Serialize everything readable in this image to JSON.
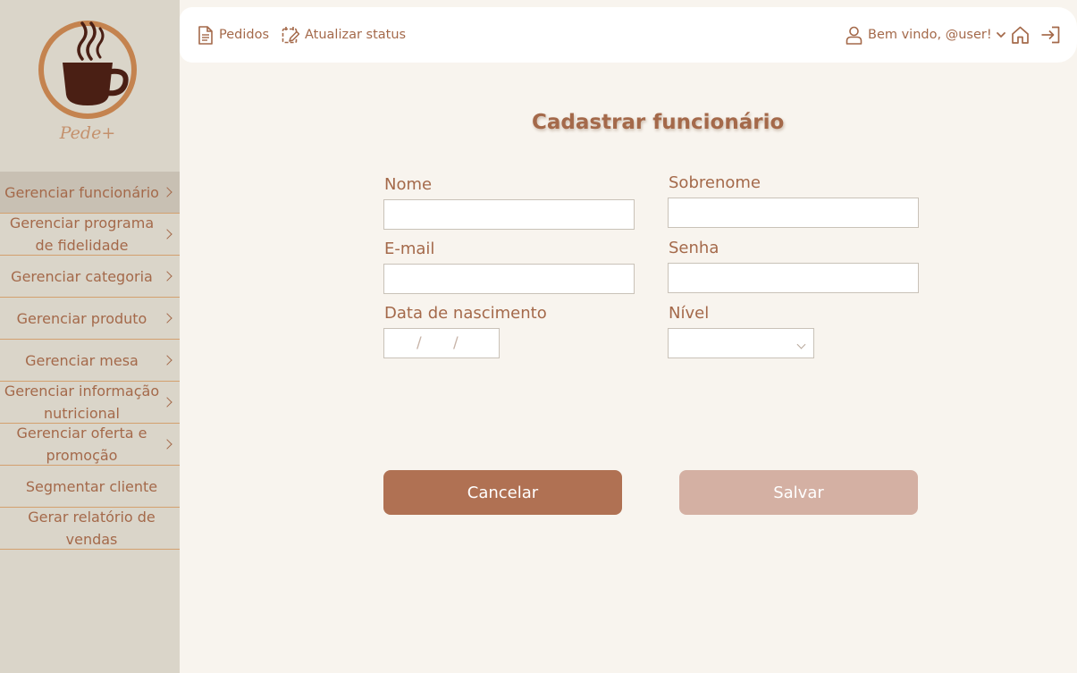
{
  "brand": {
    "name": "Pede+"
  },
  "sidebar": {
    "items": [
      {
        "label": "Gerenciar funcionário",
        "active": true,
        "arrow": true
      },
      {
        "label": "Gerenciar programa de fidelidade",
        "active": false,
        "arrow": true
      },
      {
        "label": "Gerenciar categoria",
        "active": false,
        "arrow": true
      },
      {
        "label": "Gerenciar produto",
        "active": false,
        "arrow": true
      },
      {
        "label": "Gerenciar mesa",
        "active": false,
        "arrow": true
      },
      {
        "label": "Gerenciar informação nutricional",
        "active": false,
        "arrow": true
      },
      {
        "label": "Gerenciar oferta e promoção",
        "active": false,
        "arrow": true
      },
      {
        "label": "Segmentar cliente",
        "active": false,
        "arrow": false
      },
      {
        "label": "Gerar relatório de vendas",
        "active": false,
        "arrow": false
      }
    ]
  },
  "topbar": {
    "orders_label": "Pedidos",
    "orders_icon": "document-icon",
    "status_label": "Atualizar status",
    "status_icon": "calendar-edit-icon",
    "user_label": "Bem vindo, @user!",
    "user_icon": "user-icon",
    "home_icon": "home-icon",
    "logout_icon": "logout-icon"
  },
  "form": {
    "title": "Cadastrar funcionário",
    "name_label": "Nome",
    "name_value": "",
    "surname_label": "Sobrenome",
    "surname_value": "",
    "email_label": "E-mail",
    "email_value": "",
    "password_label": "Senha",
    "password_value": "",
    "birthdate_label": "Data de nascimento",
    "birthdate_separator": "/",
    "level_label": "Nível",
    "level_value": "",
    "cancel_label": "Cancelar",
    "save_label": "Salvar"
  },
  "colors": {
    "accent": "#a4694a",
    "sidebar_bg": "#dad5c9",
    "page_bg": "#f8f4ee",
    "cancel_button": "#b07153",
    "save_button": "#d4b0a3"
  }
}
